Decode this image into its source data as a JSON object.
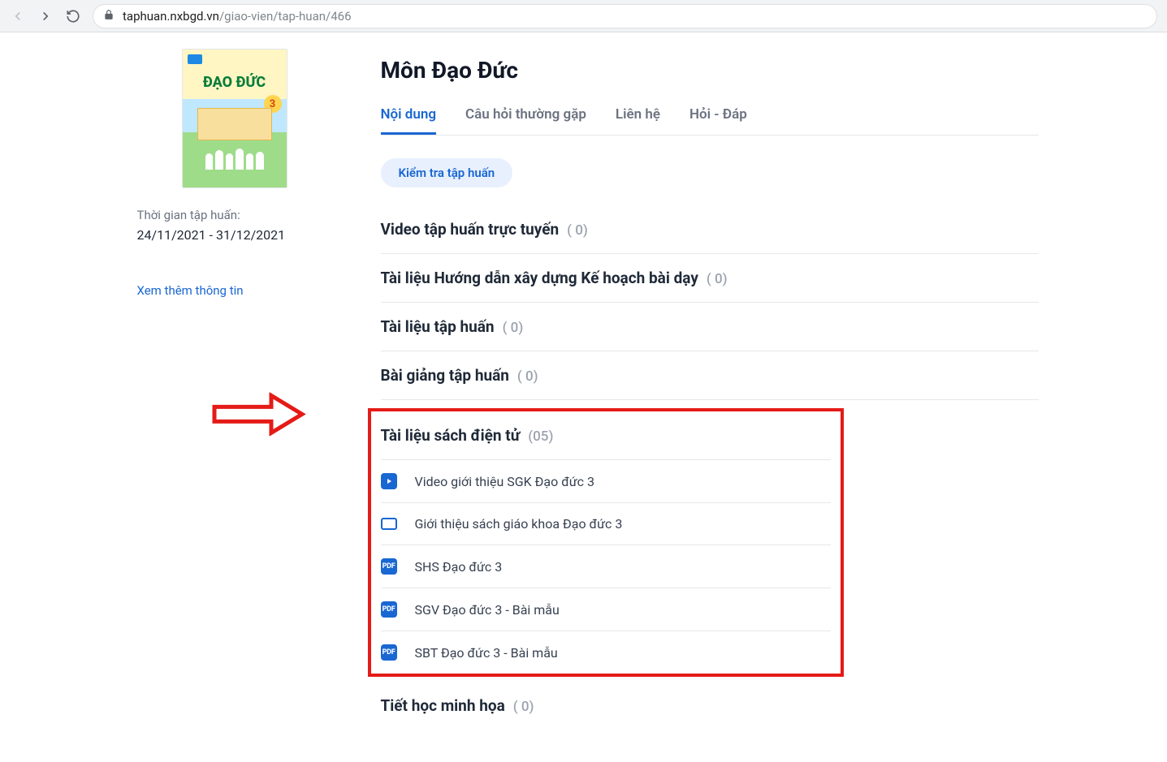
{
  "browser": {
    "url_host": "taphuan.nxbgd.vn",
    "url_path": "/giao-vien/tap-huan/466"
  },
  "book": {
    "title_on_cover": "ĐẠO ĐỨC",
    "grade": "3"
  },
  "sidebar": {
    "period_label": "Thời gian tập huấn:",
    "period_value": "24/11/2021 - 31/12/2021",
    "more_link": "Xem thêm thông tin"
  },
  "main": {
    "title": "Môn Đạo Đức",
    "tabs": [
      {
        "label": "Nội dung",
        "active": true
      },
      {
        "label": "Câu hỏi thường gặp",
        "active": false
      },
      {
        "label": "Liên hệ",
        "active": false
      },
      {
        "label": "Hỏi - Đáp",
        "active": false
      }
    ],
    "check_button": "Kiểm tra tập huấn",
    "sections_top": [
      {
        "title": "Video tập huấn trực tuyến",
        "count": "( 0)"
      },
      {
        "title": "Tài liệu Hướng dẫn xây dựng Kế hoạch bài dạy",
        "count": "( 0)"
      },
      {
        "title": "Tài liệu tập huấn",
        "count": "( 0)"
      },
      {
        "title": "Bài giảng tập huấn",
        "count": "( 0)"
      }
    ],
    "ebook_section": {
      "title": "Tài liệu sách điện tử",
      "count": "(05)",
      "items": [
        {
          "type": "video-fill",
          "label": "Video giới thiệu SGK Đạo đức 3",
          "icon_name": "video-play-icon"
        },
        {
          "type": "video-outline",
          "label": "Giới thiệu sách giáo khoa Đạo đức 3",
          "icon_name": "presentation-icon"
        },
        {
          "type": "pdf",
          "label": "SHS Đạo đức 3",
          "icon_name": "pdf-icon"
        },
        {
          "type": "pdf",
          "label": "SGV Đạo đức 3 - Bài mẫu",
          "icon_name": "pdf-icon"
        },
        {
          "type": "pdf",
          "label": "SBT Đạo đức 3 - Bài mẫu",
          "icon_name": "pdf-icon"
        }
      ]
    },
    "sections_bottom": [
      {
        "title": "Tiết học minh họa",
        "count": "( 0)"
      }
    ]
  }
}
